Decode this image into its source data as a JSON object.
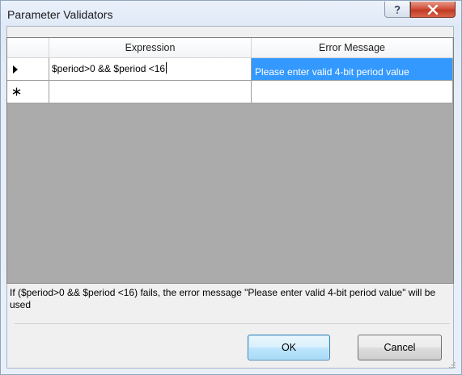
{
  "window": {
    "title": "Parameter Validators"
  },
  "titlebar": {
    "help_icon": "help-icon",
    "close_icon": "close-icon"
  },
  "grid": {
    "columns": [
      "Expression",
      "Error Message"
    ],
    "rows": [
      {
        "marker": "current-row-arrow-icon",
        "expression": "$period>0 && $period <16",
        "error_message": "Please enter valid 4-bit period value",
        "selected_cell": "error_message"
      },
      {
        "marker": "new-row-asterisk-icon",
        "expression": "",
        "error_message": ""
      }
    ]
  },
  "message": "If ($period>0 && $period <16) fails, the error message \"Please enter valid 4-bit period value\" will be used",
  "buttons": {
    "ok": "OK",
    "cancel": "Cancel"
  },
  "colors": {
    "selection": "#3399ff",
    "grid_background": "#ababab",
    "close_button": "#c94a33"
  }
}
